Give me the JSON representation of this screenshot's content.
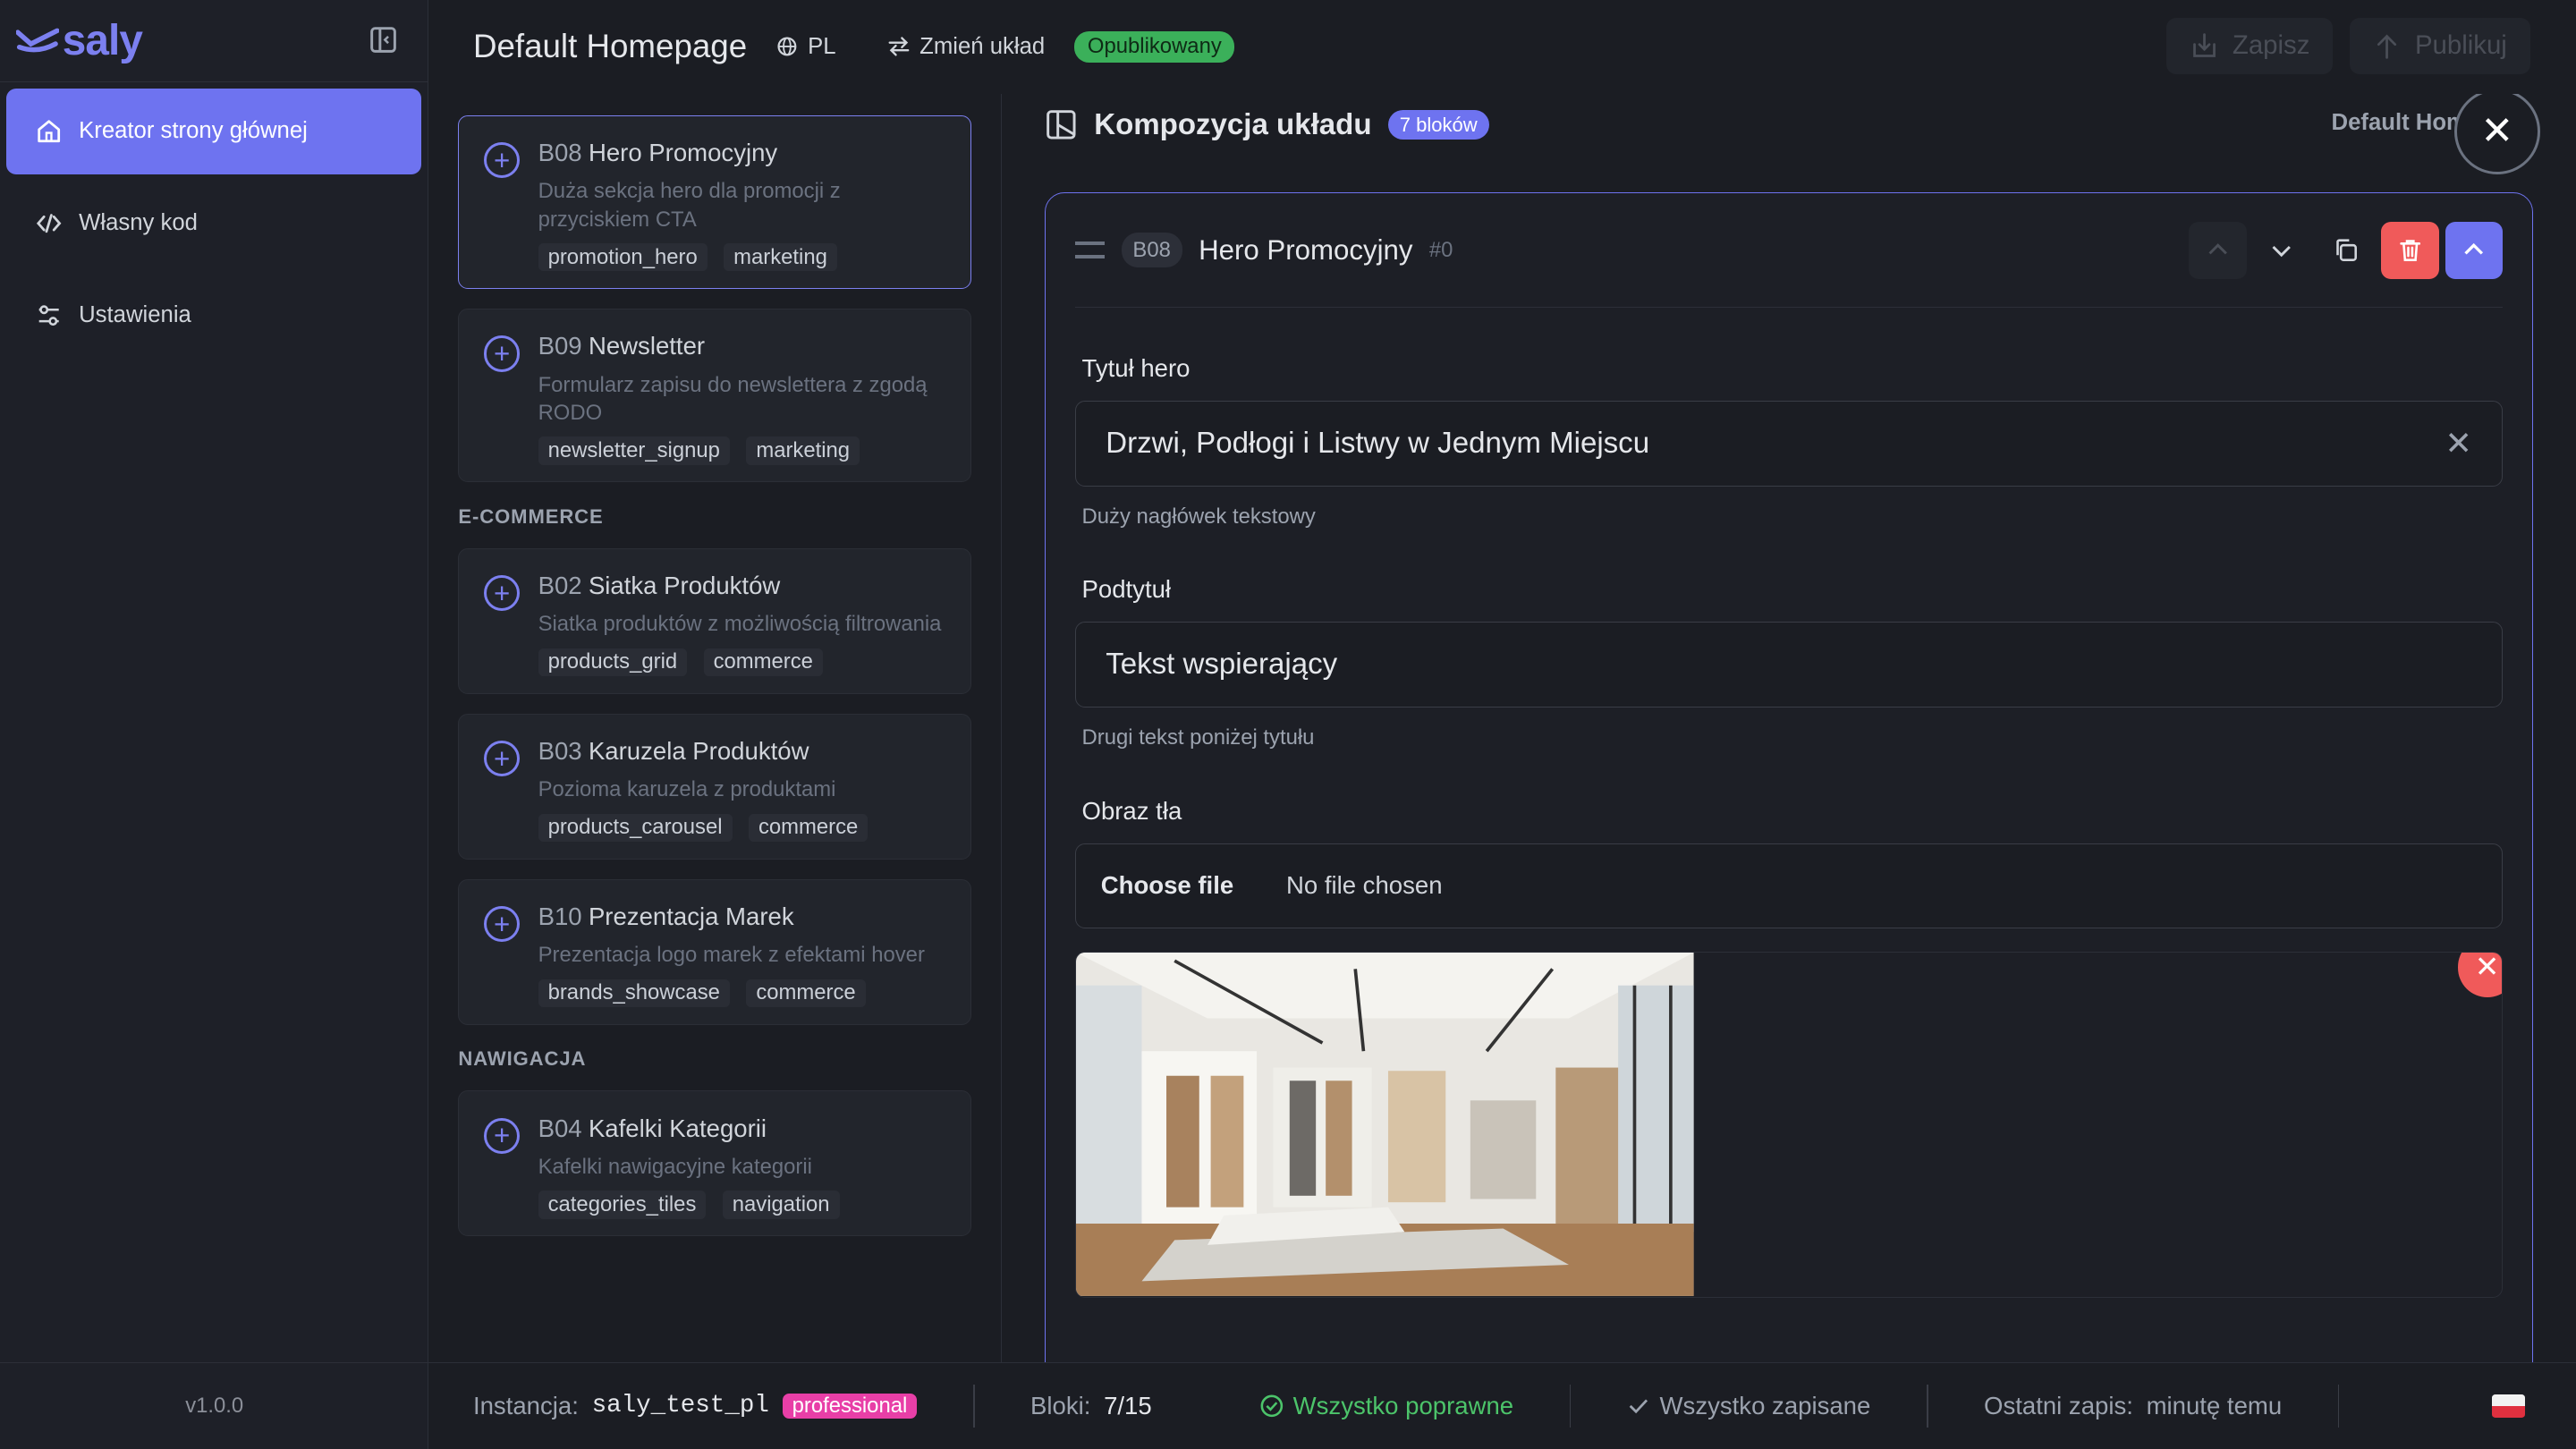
{
  "brand": {
    "name": "saly",
    "accent": "#6e73f0"
  },
  "sidebar": {
    "items": [
      {
        "label": "Kreator strony głównej",
        "icon": "home-icon",
        "active": true
      },
      {
        "label": "Własny kod",
        "icon": "code-icon",
        "active": false
      },
      {
        "label": "Ustawienia",
        "icon": "sliders-icon",
        "active": false
      }
    ],
    "version": "v1.0.0"
  },
  "header": {
    "title": "Default Homepage",
    "language": "PL",
    "change_layout": "Zmień układ",
    "status_badge": "Opublikowany",
    "save_label": "Zapisz",
    "publish_label": "Publikuj"
  },
  "library": {
    "top_cards": [
      {
        "code": "B08",
        "title": "Hero Promocyjny",
        "desc": "Duża sekcja hero dla promocji z przyciskiem CTA",
        "tags": [
          "promotion_hero",
          "marketing"
        ],
        "selected": true
      },
      {
        "code": "B09",
        "title": "Newsletter",
        "desc": "Formularz zapisu do newslettera z zgodą RODO",
        "tags": [
          "newsletter_signup",
          "marketing"
        ],
        "selected": false
      }
    ],
    "sections": [
      {
        "title": "E-COMMERCE",
        "cards": [
          {
            "code": "B02",
            "title": "Siatka Produktów",
            "desc": "Siatka produktów z możliwością filtrowania",
            "tags": [
              "products_grid",
              "commerce"
            ]
          },
          {
            "code": "B03",
            "title": "Karuzela Produktów",
            "desc": "Pozioma karuzela z produktami",
            "tags": [
              "products_carousel",
              "commerce"
            ]
          },
          {
            "code": "B10",
            "title": "Prezentacja Marek",
            "desc": "Prezentacja logo marek z efektami hover",
            "tags": [
              "brands_showcase",
              "commerce"
            ]
          }
        ]
      },
      {
        "title": "NAWIGACJA",
        "cards": [
          {
            "code": "B04",
            "title": "Kafelki Kategorii",
            "desc": "Kafelki nawigacyjne kategorii",
            "tags": [
              "categories_tiles",
              "navigation"
            ]
          }
        ]
      }
    ]
  },
  "composition": {
    "title": "Kompozycja układu",
    "count_badge": "7 bloków",
    "right_label": "Default Homepage",
    "block": {
      "code": "B08",
      "name": "Hero Promocyjny",
      "index": "#0",
      "fields": {
        "title_label": "Tytuł hero",
        "title_value": "Drzwi, Podłogi i Listwy w Jednym Miejscu",
        "title_hint": "Duży nagłówek tekstowy",
        "subtitle_label": "Podtytuł",
        "subtitle_value": "Tekst wspierający",
        "subtitle_hint": "Drugi tekst poniżej tytułu",
        "image_label": "Obraz tła",
        "choose_file": "Choose file",
        "no_file": "No file chosen"
      }
    }
  },
  "status": {
    "instance_label": "Instancja:",
    "instance_value": "saly_test_pl",
    "plan": "professional",
    "blocks_label": "Bloki:",
    "blocks_value": "7/15",
    "valid": "Wszystko poprawne",
    "saved": "Wszystko zapisane",
    "last_save_label": "Ostatni zapis:",
    "last_save_value": "minutę temu"
  }
}
